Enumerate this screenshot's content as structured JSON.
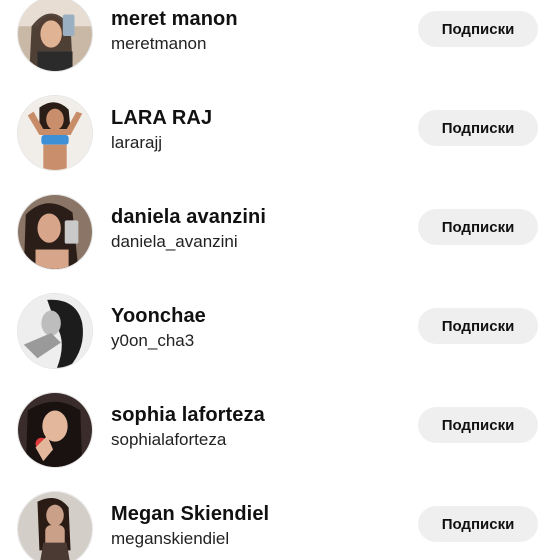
{
  "following_list": [
    {
      "name": "meret manon",
      "username": "meretmanon",
      "button_label": "Подписки"
    },
    {
      "name": "LARA RAJ",
      "username": "lararajj",
      "button_label": "Подписки"
    },
    {
      "name": "daniela avanzini",
      "username": "daniela_avanzini",
      "button_label": "Подписки"
    },
    {
      "name": "Yoonchae",
      "username": "y0on_cha3",
      "button_label": "Подписки"
    },
    {
      "name": "sophia laforteza",
      "username": "sophialaforteza",
      "button_label": "Подписки"
    },
    {
      "name": "Megan Skiendiel",
      "username": "meganskiendiel",
      "button_label": "Подписки"
    }
  ],
  "colors": {
    "button_bg": "#efefef",
    "text": "#111111"
  }
}
